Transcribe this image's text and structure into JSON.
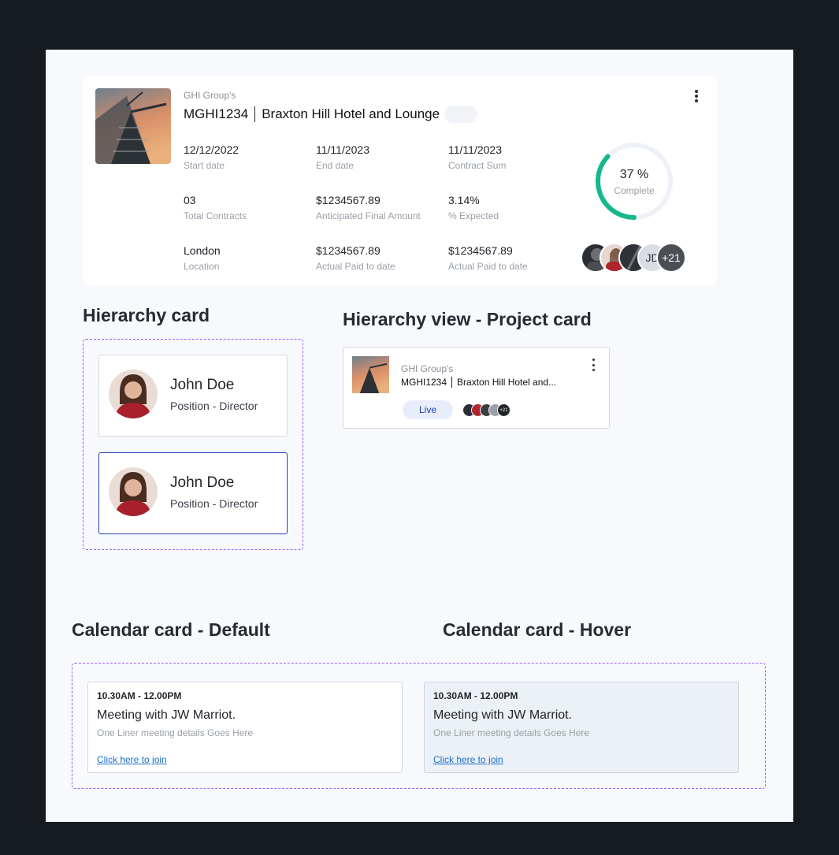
{
  "project_card": {
    "group": "GHI Group's",
    "code": "MGHI1234",
    "name": "Braxton Hill Hotel and Lounge",
    "stats": [
      {
        "value": "12/12/2022",
        "label": "Start date"
      },
      {
        "value": "11/11/2023",
        "label": "End date"
      },
      {
        "value": "11/11/2023",
        "label": "Contract Sum"
      },
      {
        "value": "03",
        "label": "Total Contracts"
      },
      {
        "value": "$1234567.89",
        "label": "Anticipated Final Amount"
      },
      {
        "value": "3.14%",
        "label": "% Expected"
      },
      {
        "value": "London",
        "label": "Location"
      },
      {
        "value": "$1234567.89",
        "label": "Actual Paid to date"
      },
      {
        "value": "$1234567.89",
        "label": "Actual Paid to date"
      }
    ],
    "progress_percent": 37,
    "progress_text": "37 %",
    "progress_label": "Complete",
    "avatar_initials": "JD",
    "avatar_more": "+21",
    "colors": {
      "progress": "#14b88c",
      "track": "#eef1f7"
    }
  },
  "sections": {
    "hierarchy_card": "Hierarchy card",
    "hierarchy_view": "Hierarchy view - Project card",
    "calendar_default": "Calendar card - Default",
    "calendar_hover": "Calendar card - Hover"
  },
  "hierarchy_cards": [
    {
      "name": "John Doe",
      "position": "Position - Director"
    },
    {
      "name": "John Doe",
      "position": "Position - Director"
    }
  ],
  "small_project_card": {
    "group": "GHI Group's",
    "code": "MGHI1234",
    "name": "Braxton Hill Hotel and...",
    "status": "Live",
    "more": "+21"
  },
  "calendar_cards": [
    {
      "time": "10.30AM - 12.00PM",
      "title": "Meeting with JW Marriot.",
      "details": "One Liner meeting details Goes Here",
      "link": "Click here to join"
    },
    {
      "time": "10.30AM - 12.00PM",
      "title": "Meeting with JW Marriot.",
      "details": "One Liner meeting details Goes Here",
      "link": "Click here to join"
    }
  ]
}
